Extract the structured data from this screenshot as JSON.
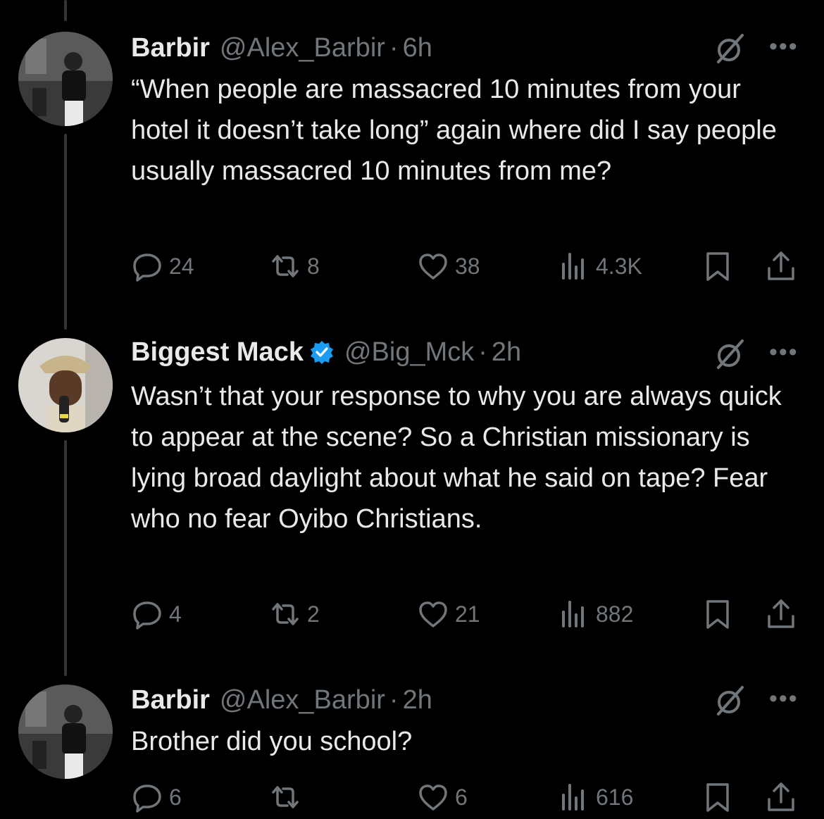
{
  "tweets": [
    {
      "name": "Barbir",
      "handle": "@Alex_Barbir",
      "time": "6h",
      "verified": false,
      "text": "“When people are massacred 10 minutes from your hotel it doesn’t take long” again where did I say people usually massacred 10 minutes from me?",
      "replies": "24",
      "retweets": "8",
      "likes": "38",
      "views": "4.3K"
    },
    {
      "name": "Biggest Mack",
      "handle": "@Big_Mck",
      "time": "2h",
      "verified": true,
      "text": "Wasn’t that your response to why you are always quick to appear at the scene? So a Christian missionary is lying broad daylight about what he said on tape? Fear who no fear Oyibo Christians.",
      "replies": "4",
      "retweets": "2",
      "likes": "21",
      "views": "882"
    },
    {
      "name": "Barbir",
      "handle": "@Alex_Barbir",
      "time": "2h",
      "verified": false,
      "text": "Brother did you school?",
      "replies": "6",
      "retweets": "",
      "likes": "6",
      "views": "616"
    }
  ],
  "colors": {
    "background": "#000000",
    "text": "#e7e9ea",
    "muted": "#71767b",
    "verified": "#1d9bf0",
    "thread_line": "#333639"
  },
  "icons": [
    "reply-icon",
    "retweet-icon",
    "like-icon",
    "views-icon",
    "bookmark-icon",
    "share-icon",
    "grok-icon",
    "more-icon"
  ]
}
